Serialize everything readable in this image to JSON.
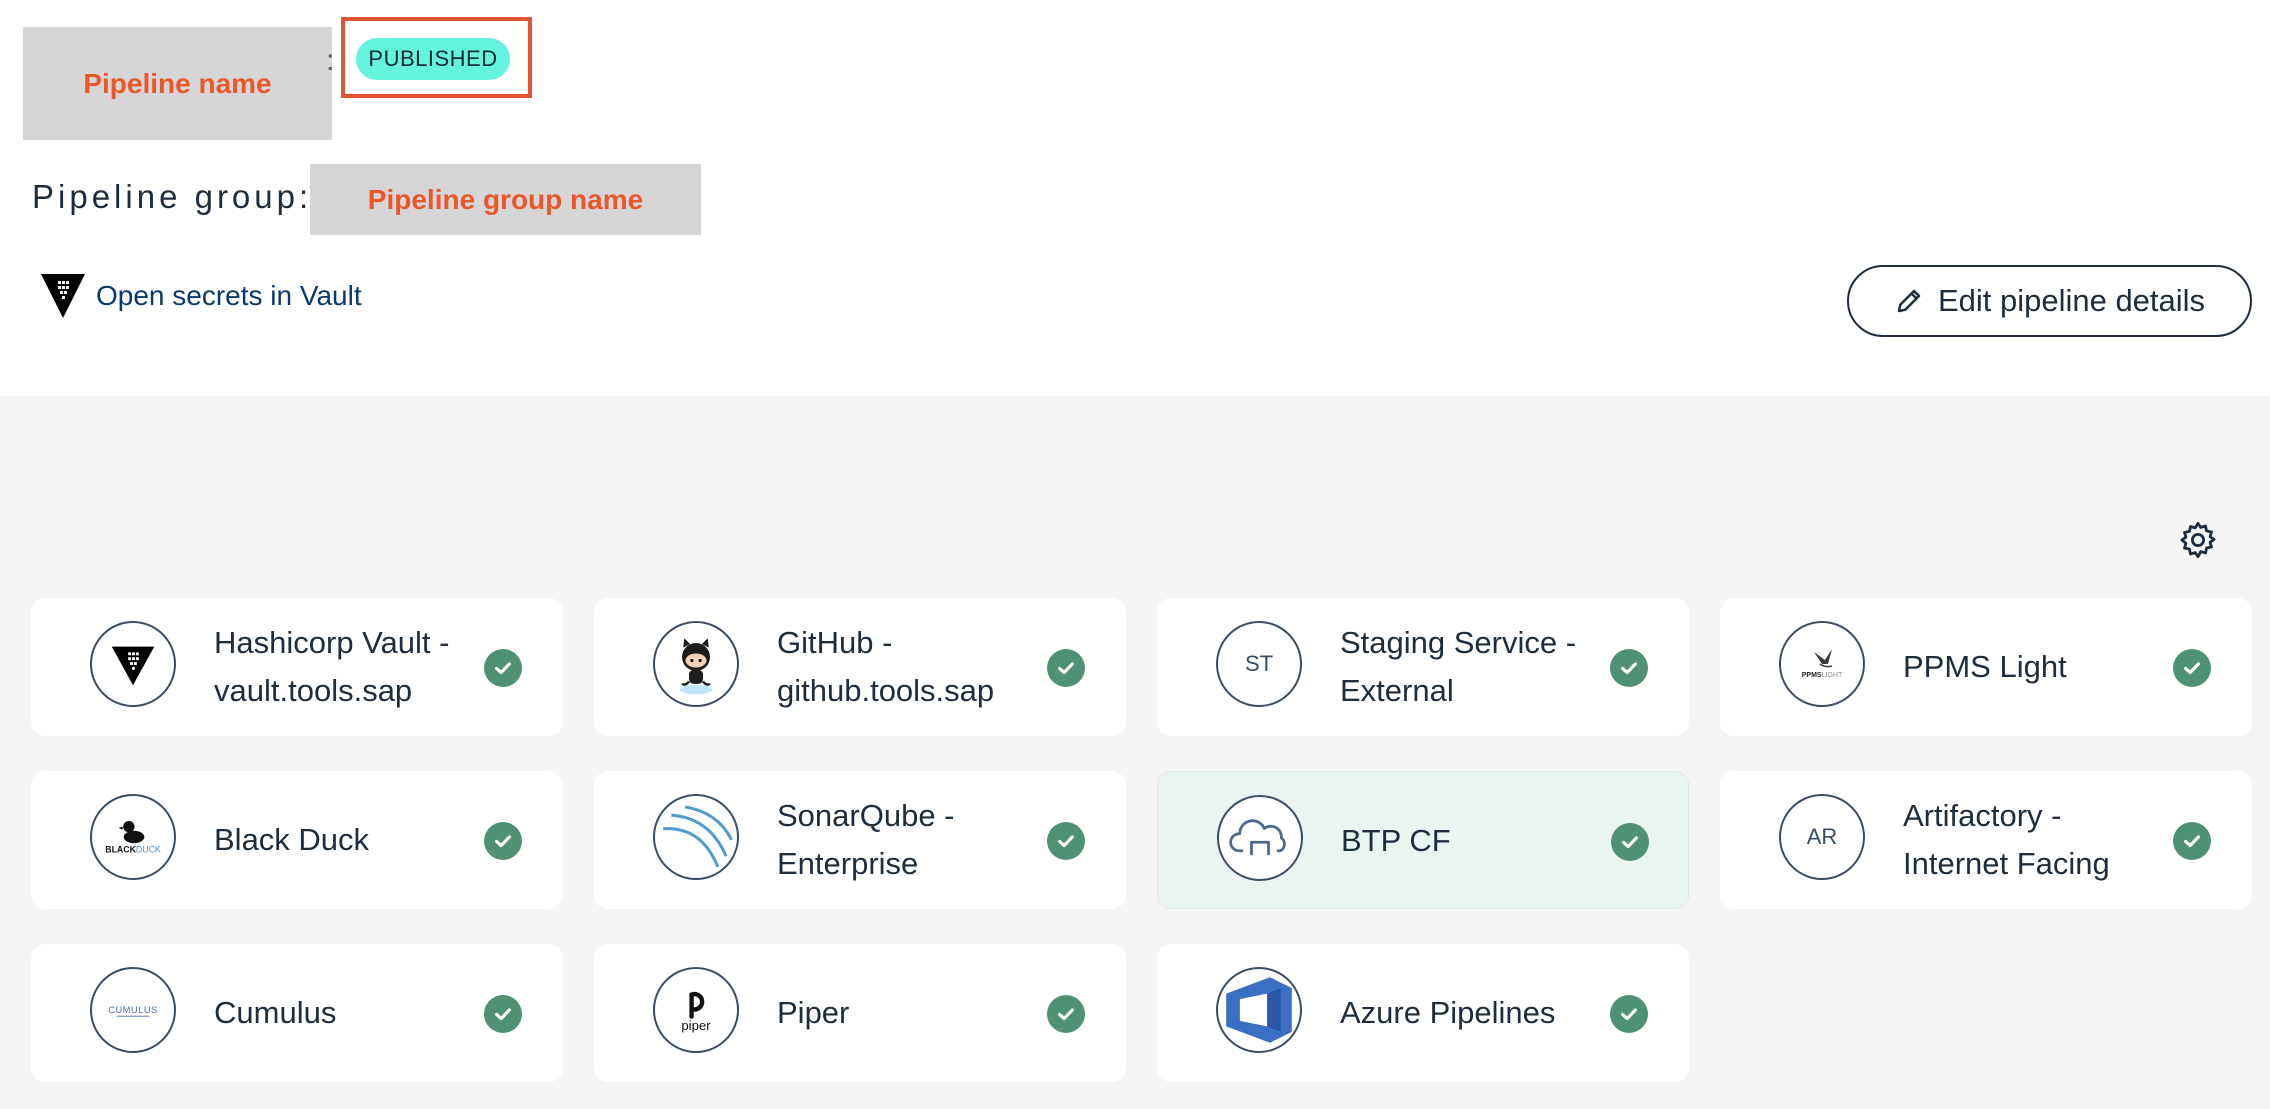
{
  "header": {
    "pipeline_name_placeholder": "Pipeline name",
    "name_separator": ":",
    "status_badge": "PUBLISHED",
    "group_label": "Pipeline group:",
    "group_name_placeholder": "Pipeline group name",
    "vault_link": "Open secrets in Vault",
    "edit_button": "Edit pipeline details"
  },
  "colors": {
    "accent_check": "#4f9175",
    "badge": "#64f3dd",
    "placeholder_text": "#e9572b",
    "highlight_border": "#e45433"
  },
  "tools": [
    {
      "label": "Hashicorp Vault - vault.tools.sap",
      "icon": "vault-logo-icon",
      "status": "check"
    },
    {
      "label": "GitHub - github.tools.sap",
      "icon": "github-octocat-icon",
      "status": "check"
    },
    {
      "label": "Staging Service - External",
      "icon_text": "ST",
      "icon": "st-initials-icon",
      "status": "check"
    },
    {
      "label": "PPMS Light",
      "icon": "ppms-light-logo-icon",
      "status": "check"
    },
    {
      "label": "Black Duck",
      "icon": "black-duck-logo-icon",
      "status": "check"
    },
    {
      "label": "SonarQube - Enterprise",
      "icon": "sonarqube-logo-icon",
      "status": "check"
    },
    {
      "label": "BTP CF",
      "icon": "btp-cloud-icon",
      "status": "check",
      "selected": true
    },
    {
      "label": "Artifactory - Internet Facing",
      "icon_text": "AR",
      "icon": "ar-initials-icon",
      "status": "check"
    },
    {
      "label": "Cumulus",
      "icon": "cumulus-logo-icon",
      "status": "check"
    },
    {
      "label": "Piper",
      "icon": "piper-logo-icon",
      "status": "check"
    },
    {
      "label": "Azure Pipelines",
      "icon": "azure-pipelines-logo-icon",
      "status": "check"
    }
  ]
}
